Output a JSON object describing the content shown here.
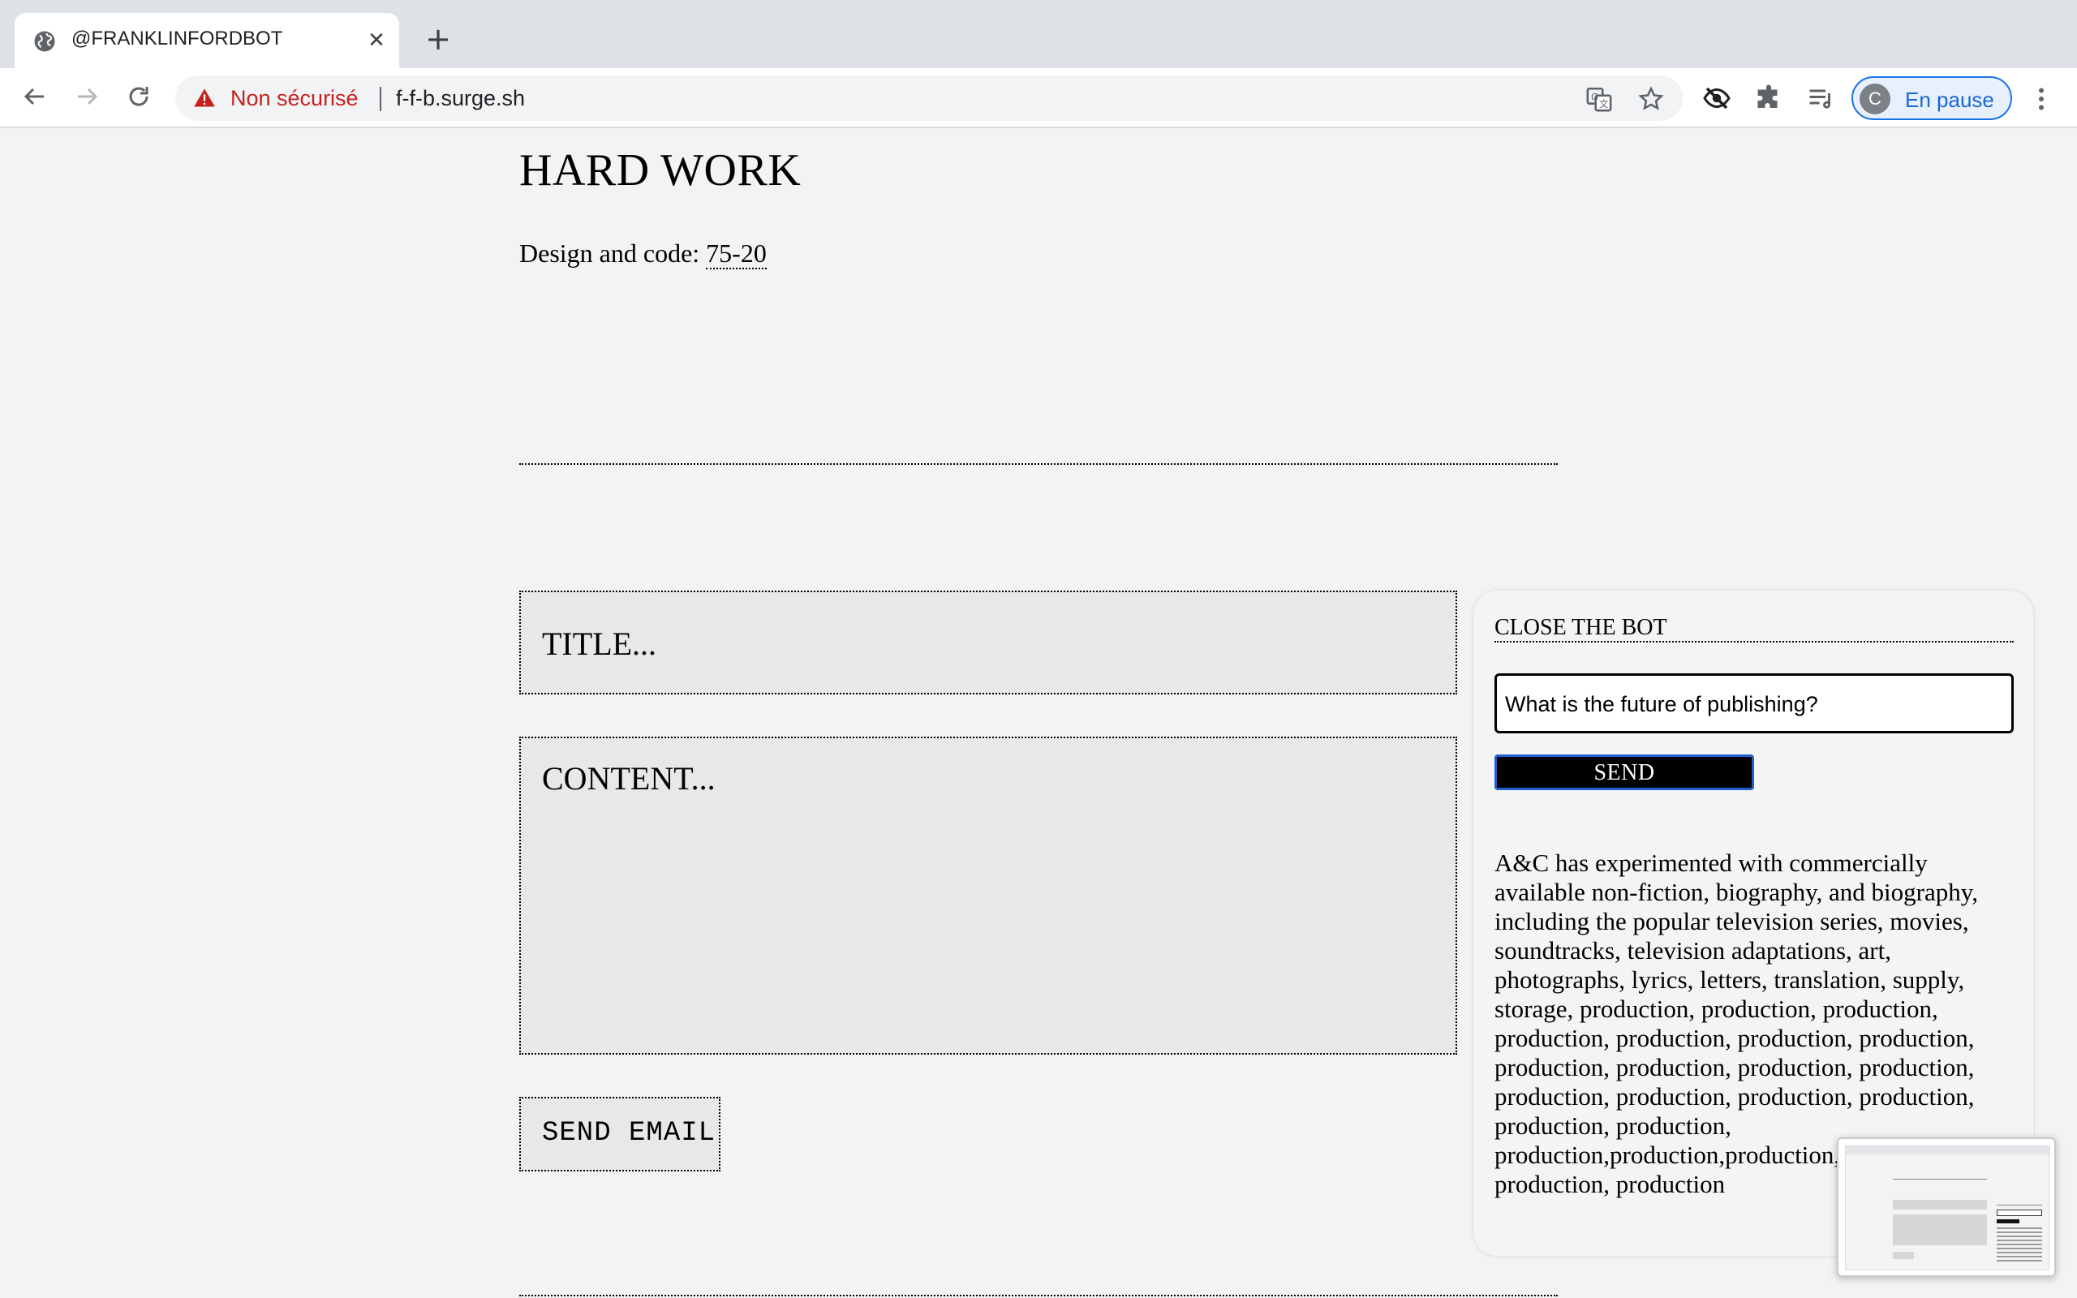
{
  "browser": {
    "tab_title": "@FRANKLINFORDBOT",
    "security_label": "Non sécurisé",
    "url": "f-f-b.surge.sh",
    "profile_initial": "C",
    "profile_label": "En pause"
  },
  "page": {
    "title": "HARD WORK",
    "credits_prefix": "Design and code: ",
    "credits_link": "75-20"
  },
  "form": {
    "title_placeholder": "TITLE...",
    "content_placeholder": "CONTENT...",
    "send_label": "SEND EMAIL"
  },
  "bot": {
    "close_label": "CLOSE THE BOT",
    "question": "What is the future of publishing?",
    "send_label": "SEND",
    "response": "A&C has experimented with commercially available non-fiction, biography, and biography, including the popular television series, movies, soundtracks, television adaptations, art, photographs, lyrics, letters, translation, supply, storage, production, production, production, production, production, production, production, production, production, production, production, production, production, production, production, production, production, production,production,production, production, production, production"
  }
}
